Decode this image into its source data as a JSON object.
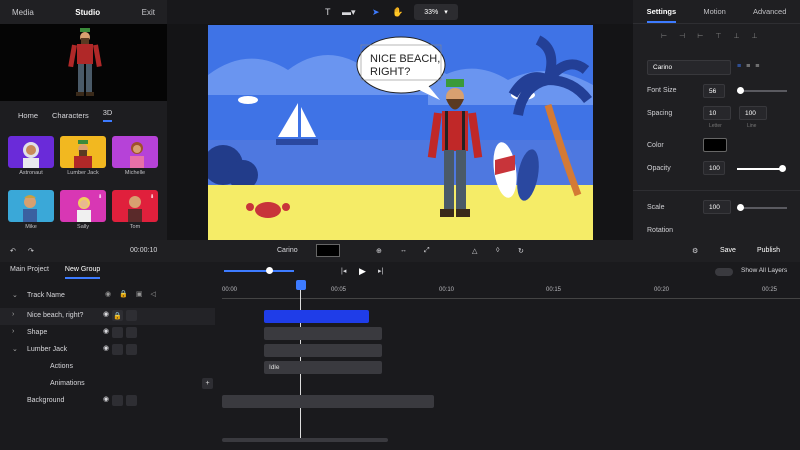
{
  "top_tabs": {
    "media": "Media",
    "studio": "Studio",
    "exit": "Exit"
  },
  "library_tabs": [
    "Home",
    "Characters",
    "3D"
  ],
  "characters": [
    {
      "name": "Astronaut",
      "bg": "#6a2bd9"
    },
    {
      "name": "Lumber Jack",
      "bg": "#f2b820"
    },
    {
      "name": "Michelle",
      "bg": "#b642d8"
    },
    {
      "name": "Mike",
      "bg": "#3aa8d8"
    },
    {
      "name": "Sally",
      "bg": "#d837b4"
    },
    {
      "name": "Tom",
      "bg": "#e0203c"
    }
  ],
  "toolbar": {
    "zoom": "33%"
  },
  "scene": {
    "speech": "NICE BEACH, RIGHT?"
  },
  "right_panel": {
    "tabs": [
      "Settings",
      "Motion",
      "Advanced"
    ],
    "font_value": "Carino",
    "font_size_label": "Font Size",
    "font_size": "56",
    "spacing_label": "Spacing",
    "letter": "10",
    "line": "100",
    "letter_label": "Letter",
    "line_label": "Line",
    "color_label": "Color",
    "opacity_label": "Opacity",
    "opacity": "100",
    "scale_label": "Scale",
    "scale": "100",
    "rotation_label": "Rotation"
  },
  "bottom_bar": {
    "time": "00:00:10",
    "font_name": "Carino",
    "save": "Save",
    "publish": "Publish",
    "show_layers": "Show All Layers"
  },
  "track_tabs": [
    "Main Project",
    "New Group"
  ],
  "tracks": {
    "header": "Track Name",
    "rows": [
      "Nice beach, right?",
      "Shape",
      "Lumber Jack",
      "Actions",
      "Animations",
      "Background"
    ]
  },
  "ruler": [
    "00:00",
    "00:05",
    "00:10",
    "00:15",
    "00:20",
    "00:25"
  ],
  "clip_idle": "Idle"
}
